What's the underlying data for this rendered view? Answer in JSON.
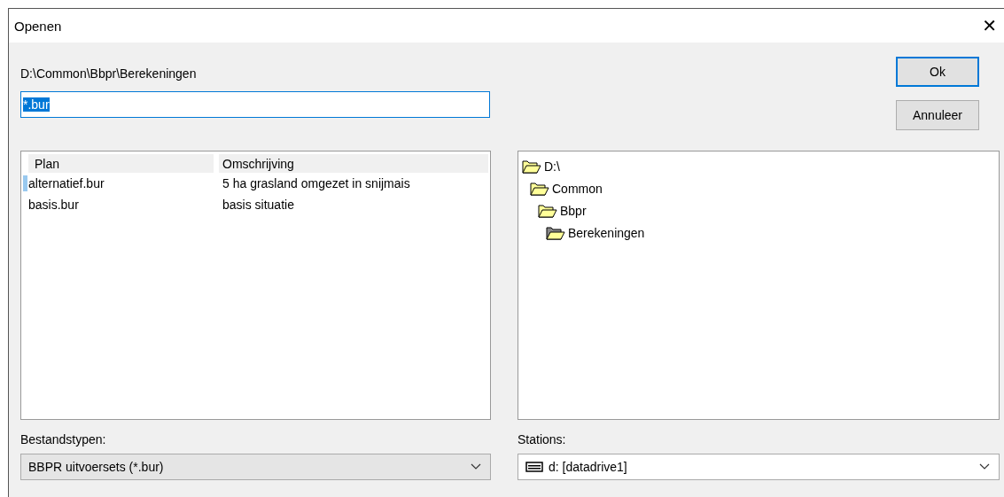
{
  "window": {
    "title": "Openen",
    "close": "✕"
  },
  "path": "D:\\Common\\Bbpr\\Berekeningen",
  "filename": {
    "value": "*.bur"
  },
  "buttons": [
    {
      "label": "Ok",
      "kind": "default"
    },
    {
      "label": "Annuleer",
      "kind": "normal"
    }
  ],
  "file_list": {
    "columns": [
      "Plan",
      "Omschrijving"
    ],
    "rows": [
      {
        "cells": [
          "alternatief.bur",
          "5 ha grasland omgezet in snijmais"
        ],
        "selected": true
      },
      {
        "cells": [
          "basis.bur",
          "basis situatie"
        ],
        "selected": false
      }
    ]
  },
  "folder_tree": [
    {
      "label": "D:\\",
      "selected": false,
      "children": [
        {
          "label": "Common",
          "selected": false,
          "children": [
            {
              "label": "Bbpr",
              "selected": false,
              "children": [
                {
                  "label": "Berekeningen",
                  "selected": true
                }
              ]
            }
          ]
        }
      ]
    }
  ],
  "file_types": {
    "label": "Bestandstypen:",
    "value": "BBPR uitvoersets (*.bur)"
  },
  "stations": {
    "label": "Stations:",
    "value": "d: [datadrive1]"
  }
}
